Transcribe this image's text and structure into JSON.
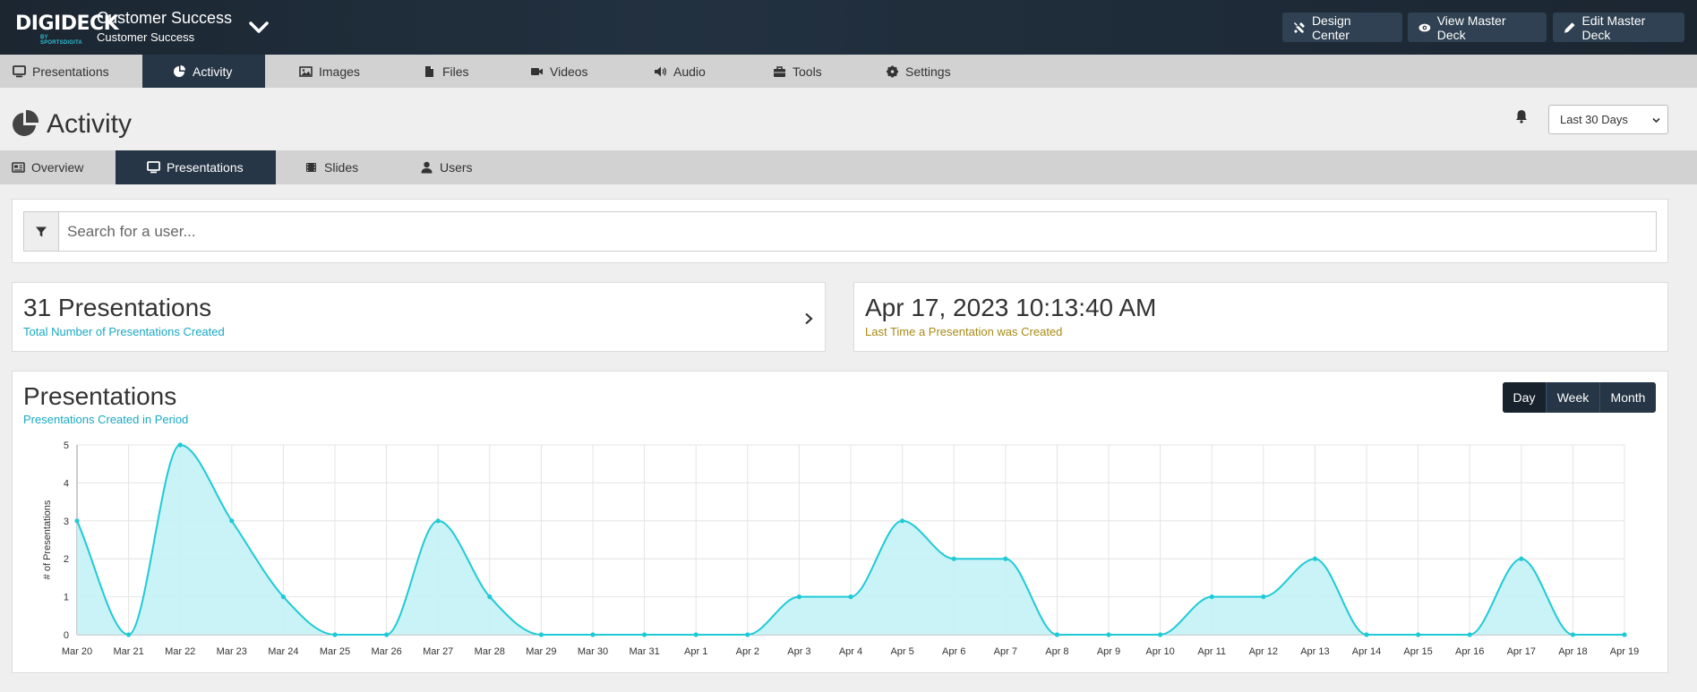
{
  "header": {
    "logo_text": "DIGIDECK",
    "logo_sub": "BY SPORTSDIGITA",
    "brand_title": "Customer Success",
    "brand_sub": "Customer Success",
    "buttons": [
      {
        "label": "Design Center",
        "icon": "design-tools-icon"
      },
      {
        "label": "View Master Deck",
        "icon": "eye-icon"
      },
      {
        "label": "Edit Master Deck",
        "icon": "pencil-icon"
      }
    ]
  },
  "main_tabs": [
    {
      "label": "Presentations",
      "icon": "monitor-icon",
      "active": false
    },
    {
      "label": "Activity",
      "icon": "pie-chart-icon",
      "active": true
    },
    {
      "label": "Images",
      "icon": "image-icon",
      "active": false
    },
    {
      "label": "Files",
      "icon": "file-icon",
      "active": false
    },
    {
      "label": "Videos",
      "icon": "video-camera-icon",
      "active": false
    },
    {
      "label": "Audio",
      "icon": "speaker-icon",
      "active": false
    },
    {
      "label": "Tools",
      "icon": "toolbox-icon",
      "active": false
    },
    {
      "label": "Settings",
      "icon": "gear-icon",
      "active": false
    }
  ],
  "page": {
    "title": "Activity",
    "period_selected": "Last 30 Days"
  },
  "sub_tabs": [
    {
      "label": "Overview",
      "icon": "newspaper-icon",
      "active": false
    },
    {
      "label": "Presentations",
      "icon": "monitor-icon",
      "active": true
    },
    {
      "label": "Slides",
      "icon": "film-icon",
      "active": false
    },
    {
      "label": "Users",
      "icon": "user-icon",
      "active": false
    }
  ],
  "search": {
    "placeholder": "Search for a user..."
  },
  "stats": {
    "count": {
      "value": "31 Presentations",
      "label": "Total Number of Presentations Created"
    },
    "last": {
      "value": "Apr 17, 2023 10:13:40 AM",
      "label": "Last Time a Presentation was Created"
    }
  },
  "chart_panel": {
    "title": "Presentations",
    "subtitle": "Presentations Created in Period",
    "toggle": [
      "Day",
      "Week",
      "Month"
    ],
    "toggle_selected": "Day"
  },
  "colors": {
    "line": "#1fcad6",
    "fill": "#c3f2f5",
    "stat_label_blue": "#19a9c4",
    "stat_label_gold": "#a88a16",
    "nav_active": "#263646"
  },
  "chart_data": {
    "type": "area",
    "title": "Presentations",
    "subtitle": "Presentations Created in Period",
    "xlabel": "",
    "ylabel": "# of Presentations",
    "ylim": [
      0,
      5
    ],
    "yticks": [
      0,
      1,
      2,
      3,
      4,
      5
    ],
    "grid": true,
    "x": [
      "Mar 20",
      "Mar 21",
      "Mar 22",
      "Mar 23",
      "Mar 24",
      "Mar 25",
      "Mar 26",
      "Mar 27",
      "Mar 28",
      "Mar 29",
      "Mar 30",
      "Mar 31",
      "Apr 1",
      "Apr 2",
      "Apr 3",
      "Apr 4",
      "Apr 5",
      "Apr 6",
      "Apr 7",
      "Apr 8",
      "Apr 9",
      "Apr 10",
      "Apr 11",
      "Apr 12",
      "Apr 13",
      "Apr 14",
      "Apr 15",
      "Apr 16",
      "Apr 17",
      "Apr 18",
      "Apr 19"
    ],
    "values": [
      3,
      0,
      5,
      3,
      1,
      0,
      0,
      3,
      1,
      0,
      0,
      0,
      0,
      0,
      1,
      1,
      3,
      2,
      2,
      0,
      0,
      0,
      1,
      1,
      2,
      0,
      0,
      0,
      2,
      0,
      0
    ]
  }
}
